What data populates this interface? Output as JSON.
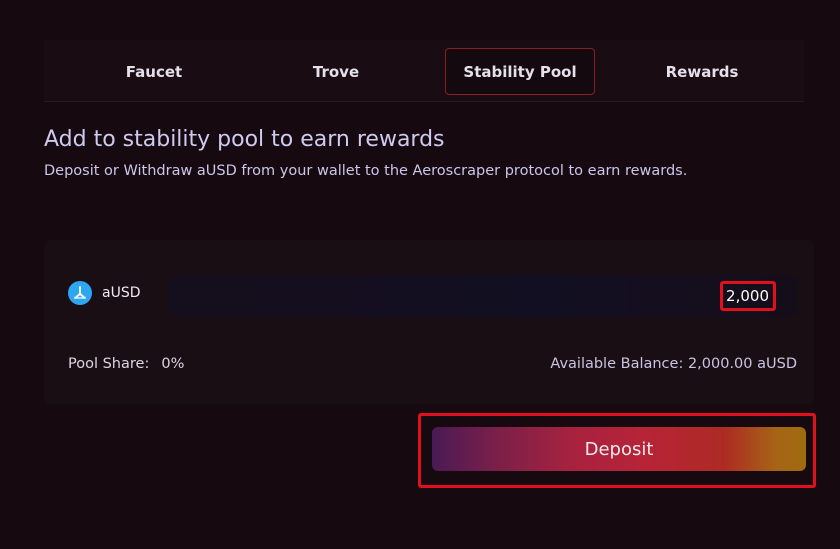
{
  "tabs": [
    {
      "label": "Faucet"
    },
    {
      "label": "Trove"
    },
    {
      "label": "Stability Pool"
    },
    {
      "label": "Rewards"
    }
  ],
  "active_tab": "Stability Pool",
  "heading": {
    "title": "Add to stability pool to earn rewards",
    "subtitle": "Deposit or Withdraw aUSD from your wallet to the Aeroscraper protocol to earn rewards."
  },
  "panel": {
    "token": {
      "symbol": "aUSD",
      "icon": "aerospace-token-icon"
    },
    "amount_value": "2,000",
    "pool_share_label": "Pool Share:",
    "pool_share_value": "0%",
    "available_balance": "Available Balance: 2,000.00 aUSD"
  },
  "deposit": {
    "label": "Deposit"
  },
  "colors": {
    "background": "#160a10",
    "accent_red": "#e0101c",
    "token_blue": "#2ea7f2"
  }
}
